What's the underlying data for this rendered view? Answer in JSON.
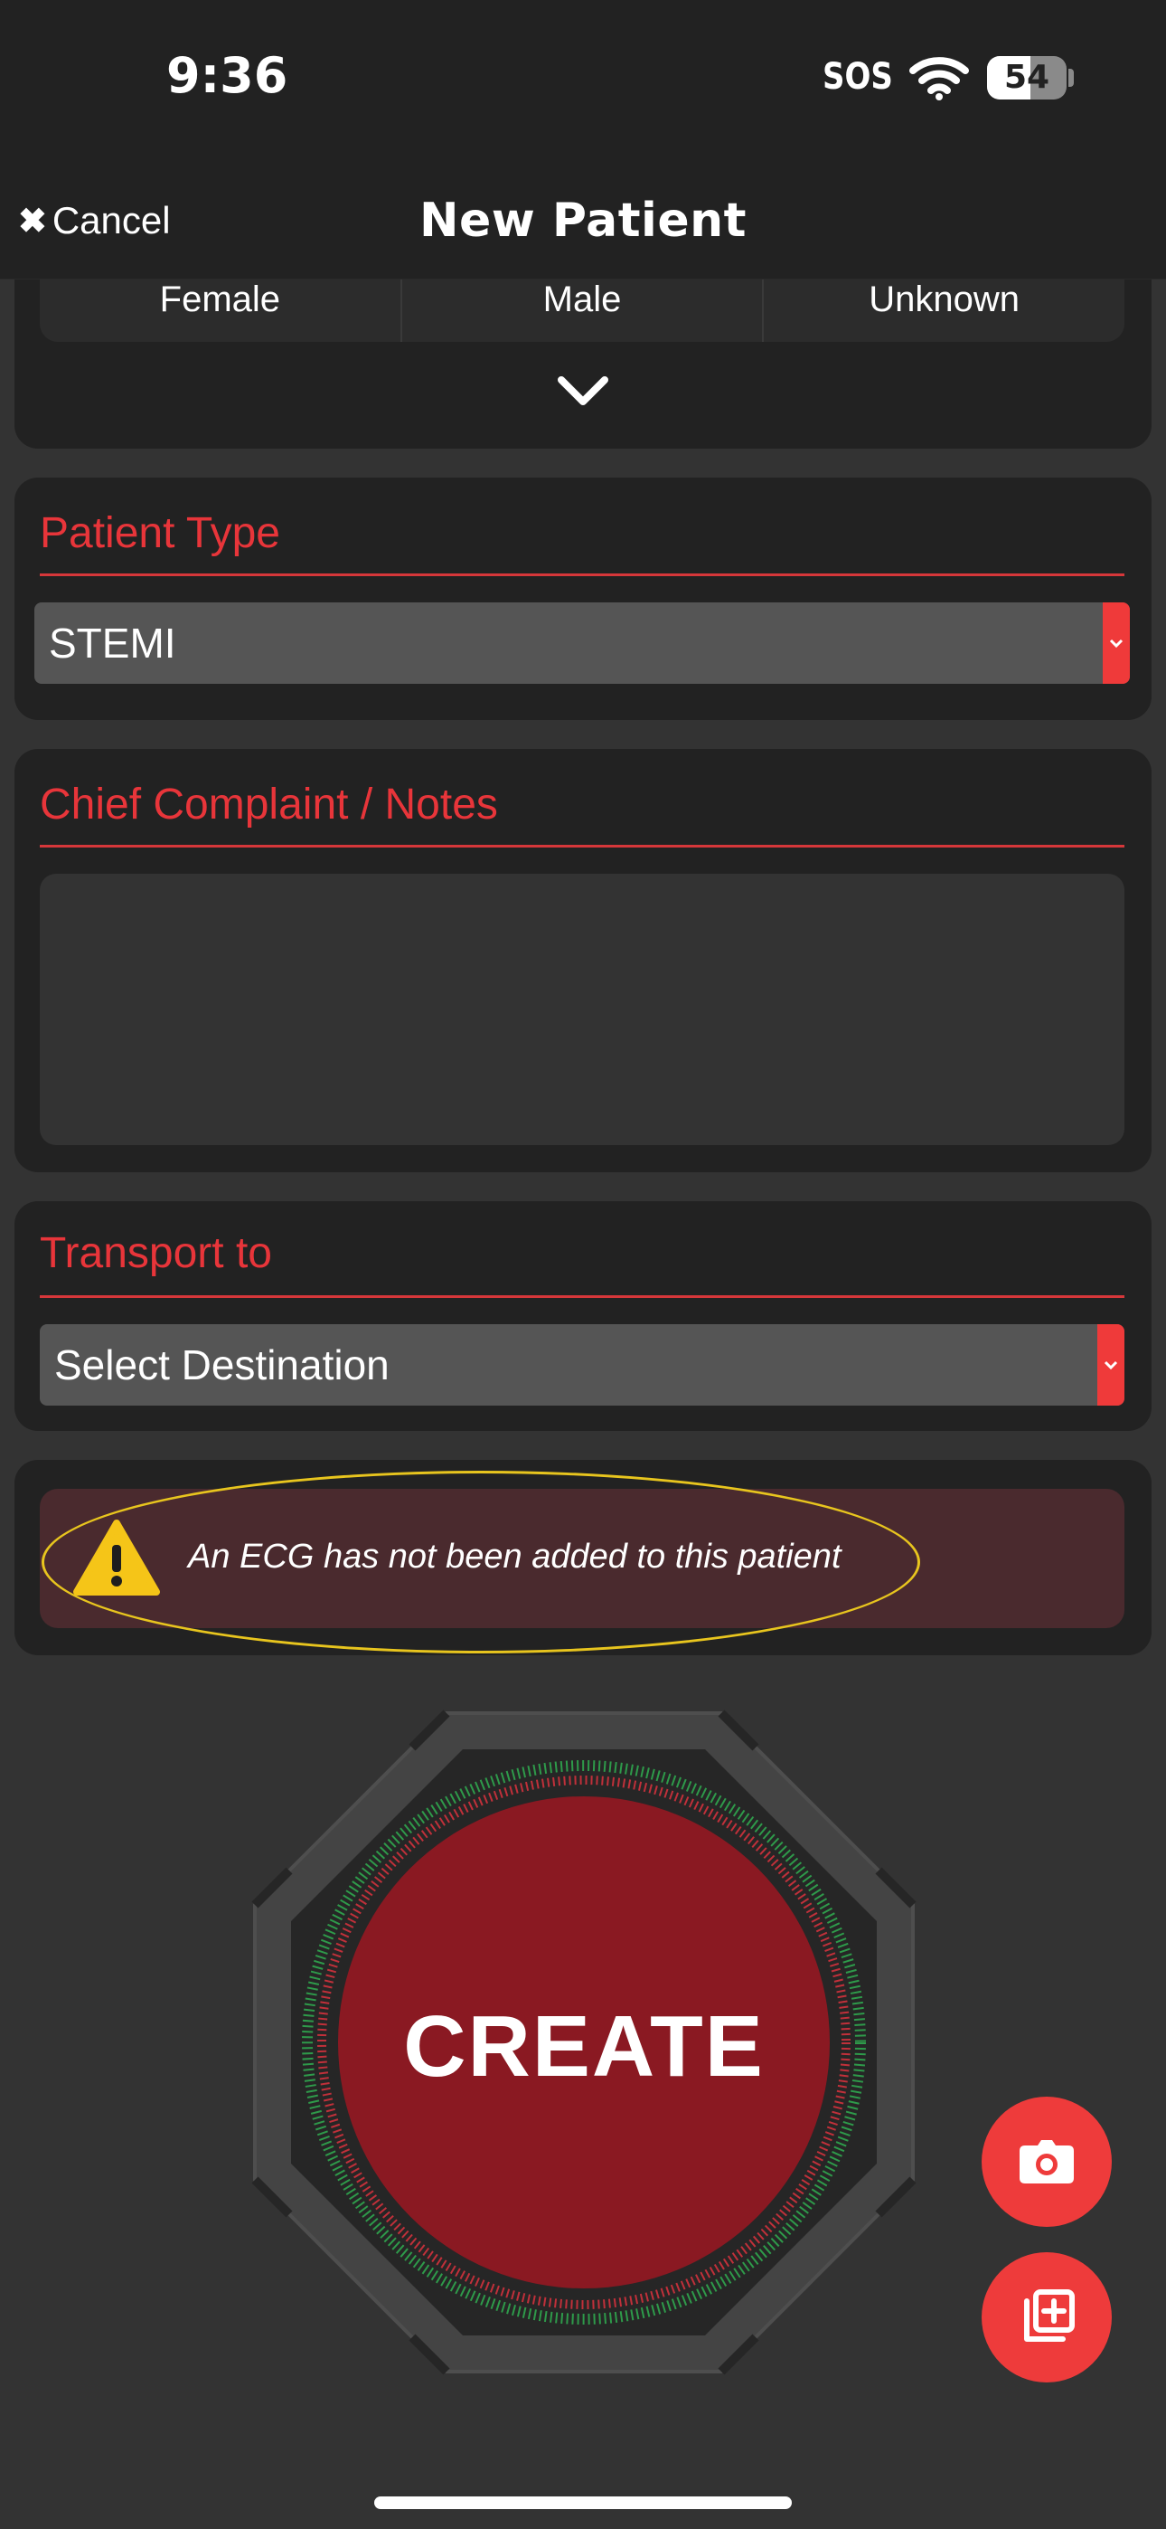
{
  "status_bar": {
    "time": "9:36",
    "carrier": "SOS",
    "battery": "54",
    "battery_level": 0.54
  },
  "nav": {
    "cancel_label": "Cancel",
    "title": "New Patient"
  },
  "sex_options": [
    "Female",
    "Male",
    "Unknown"
  ],
  "patient_type": {
    "title": "Patient Type",
    "value": "STEMI"
  },
  "chief_complaint": {
    "title": "Chief Complaint / Notes",
    "value": ""
  },
  "transport": {
    "title": "Transport to",
    "value": "Select Destination"
  },
  "ecg_warning": {
    "text": "An ECG has not been added to this patient"
  },
  "create_button": {
    "label": "CREATE"
  },
  "icons": {
    "cancel": "close-icon",
    "expand": "chevron-down-icon",
    "select_arrow": "chevron-down-icon",
    "warning": "warning-triangle-icon",
    "camera": "camera-icon",
    "add_media": "add-media-icon",
    "wifi": "wifi-icon",
    "battery": "battery-icon"
  },
  "colors": {
    "accent": "#e8353a",
    "create": "#8a1922",
    "warning_outline": "#e8c51e",
    "warning_bg": "#4a2a2e",
    "background": "#333333",
    "card": "#222222"
  }
}
